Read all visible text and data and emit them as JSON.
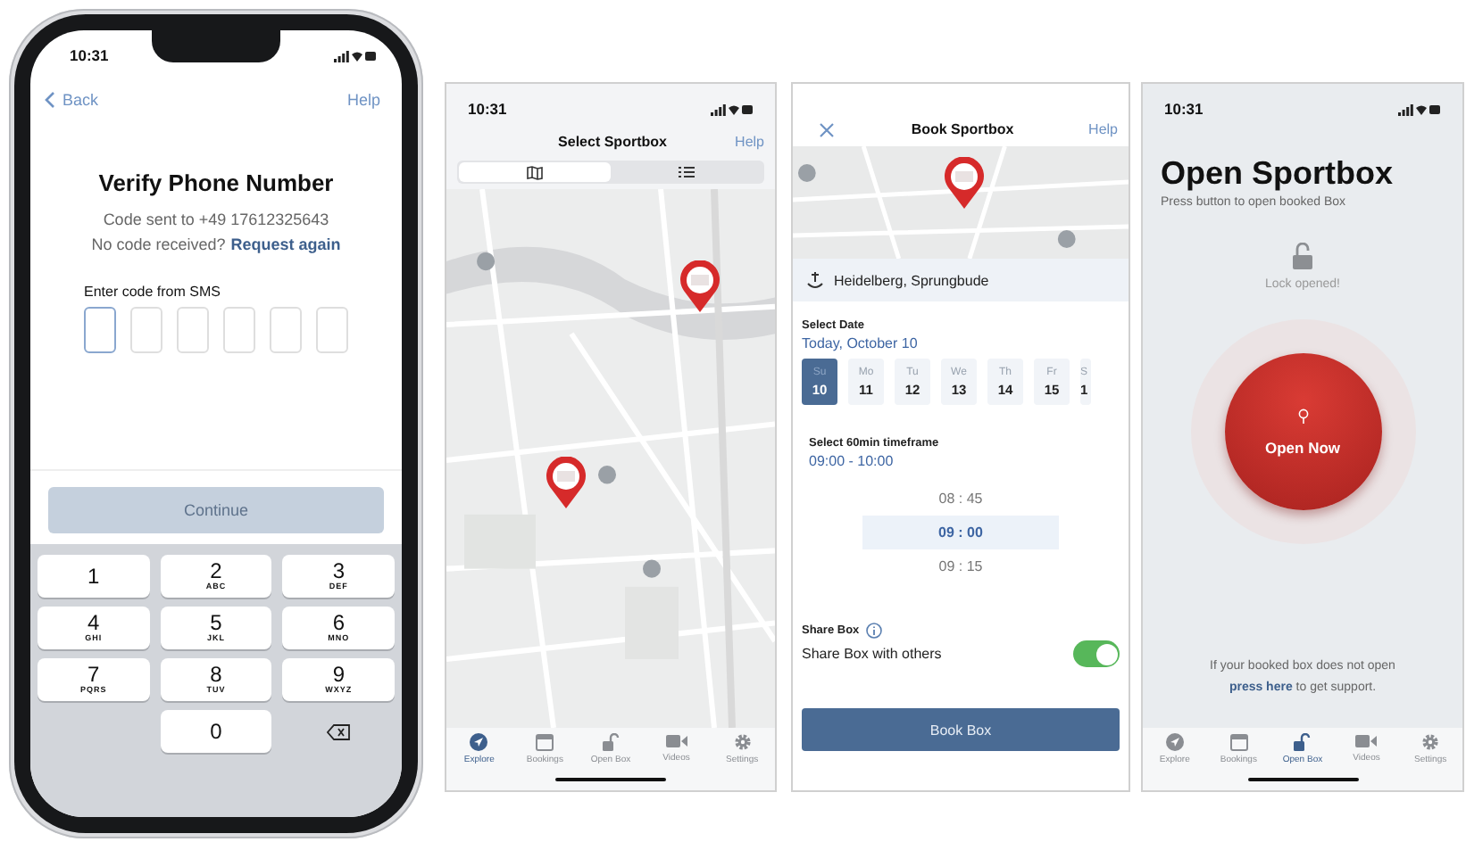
{
  "verify_screen": {
    "status_time": "10:31",
    "back_label": "Back",
    "help_label": "Help",
    "title": "Verify Phone Number",
    "sent_text": "Code sent to +49 17612325643",
    "no_code_text": "No code received?",
    "request_link": "Request again",
    "code_label": "Enter code from SMS",
    "code_boxes": [
      {
        "focused": true
      },
      {
        "focused": false
      },
      {
        "focused": false
      },
      {
        "focused": false
      },
      {
        "focused": false
      },
      {
        "focused": false
      }
    ],
    "continue_button": {
      "label": "Continue",
      "disabled": true
    },
    "keypad": [
      {
        "kind": "digit",
        "digit": "1"
      },
      {
        "kind": "digit",
        "digit": "2",
        "letters": "ABC"
      },
      {
        "kind": "digit",
        "digit": "3",
        "letters": "DEF"
      },
      {
        "kind": "digit",
        "digit": "4",
        "letters": "GHI"
      },
      {
        "kind": "digit",
        "digit": "5",
        "letters": "JKL"
      },
      {
        "kind": "digit",
        "digit": "6",
        "letters": "MNO"
      },
      {
        "kind": "digit",
        "digit": "7",
        "letters": "PQRS"
      },
      {
        "kind": "digit",
        "digit": "8",
        "letters": "TUV"
      },
      {
        "kind": "digit",
        "digit": "9",
        "letters": "WXYZ"
      },
      {
        "kind": "blank"
      },
      {
        "kind": "digit",
        "digit": "0"
      },
      {
        "kind": "delete"
      }
    ]
  },
  "select_screen": {
    "status_time": "10:31",
    "title": "Select Sportbox",
    "help_label": "Help",
    "view_toggle": [
      {
        "kind": "map",
        "selected": true
      },
      {
        "kind": "list",
        "selected": false
      }
    ],
    "tab_bar": [
      {
        "kind": "explore",
        "label": "Explore",
        "selected": true
      },
      {
        "kind": "bookings",
        "label": "Bookings",
        "selected": false
      },
      {
        "kind": "openbox",
        "label": "Open Box",
        "selected": false
      },
      {
        "kind": "videos",
        "label": "Videos",
        "selected": false
      },
      {
        "kind": "settings",
        "label": "Settings",
        "selected": false
      }
    ]
  },
  "book_screen": {
    "title": "Book Sportbox",
    "help_label": "Help",
    "location": "Heidelberg, Sprungbude",
    "date_label": "Select Date",
    "date_value": "Today, October 10",
    "days": [
      {
        "weekday": "Su",
        "day": "10",
        "selected": true
      },
      {
        "weekday": "Mo",
        "day": "11",
        "selected": false
      },
      {
        "weekday": "Tu",
        "day": "12",
        "selected": false
      },
      {
        "weekday": "We",
        "day": "13",
        "selected": false
      },
      {
        "weekday": "Th",
        "day": "14",
        "selected": false
      },
      {
        "weekday": "Fr",
        "day": "15",
        "selected": false
      },
      {
        "weekday": "S",
        "day": "1",
        "selected": false
      }
    ],
    "timeframe_label": "Select 60min timeframe",
    "timeframe_value": "09:00 - 10:00",
    "times": [
      {
        "label": "08 : 45",
        "selected": false
      },
      {
        "label": "09 : 00",
        "selected": true
      },
      {
        "label": "09 : 15",
        "selected": false
      }
    ],
    "share_label": "Share Box",
    "share_text": "Share Box with others",
    "share_on": true,
    "book_button": "Book Box"
  },
  "open_screen": {
    "status_time": "10:31",
    "title": "Open Sportbox",
    "subtitle": "Press button to open booked Box",
    "lock_status": "Lock opened!",
    "open_button": "Open Now",
    "support_before": "If your booked box does not open",
    "support_link": "press here",
    "support_after": "to get support.",
    "tab_bar": [
      {
        "kind": "explore",
        "label": "Explore",
        "selected": false
      },
      {
        "kind": "bookings",
        "label": "Bookings",
        "selected": false
      },
      {
        "kind": "openbox",
        "label": "Open Box",
        "selected": true
      },
      {
        "kind": "videos",
        "label": "Videos",
        "selected": false
      },
      {
        "kind": "settings",
        "label": "Settings",
        "selected": false
      }
    ]
  }
}
